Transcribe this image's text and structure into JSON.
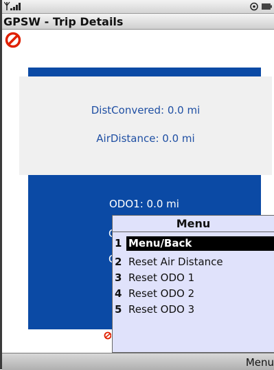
{
  "status_bar": {
    "signal_icon": "signal-bars-icon",
    "right_icons": [
      "settings-icon",
      "battery-icon"
    ]
  },
  "title_bar": {
    "title": "GPSW - Trip Details"
  },
  "stop_icon": "no-entry-icon",
  "trip_info": {
    "dist_covered": "DistConvered: 0.0 mi",
    "air_distance": "AirDistance: 0.0 mi"
  },
  "odo": {
    "odo1": "ODO1: 0.0 mi"
  },
  "menu": {
    "title": "Menu",
    "items": [
      {
        "number": "1",
        "label": "Menu/Back"
      },
      {
        "number": "2",
        "label": "Reset Air Distance"
      },
      {
        "number": "3",
        "label": "Reset ODO 1"
      },
      {
        "number": "4",
        "label": "Reset ODO 2"
      },
      {
        "number": "5",
        "label": "Reset ODO 3"
      }
    ],
    "selected_index": 0
  },
  "soft_bar": {
    "right_label": "Menu"
  },
  "colors": {
    "blue": "#0b4aa5",
    "menu_bg": "#e0e2fb",
    "text_blue": "#1f4fa3"
  }
}
